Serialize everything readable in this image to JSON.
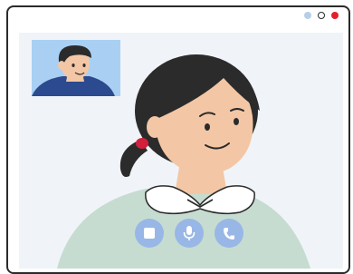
{
  "window": {
    "controls": [
      {
        "name": "minimize",
        "color": "#b7cfe6"
      },
      {
        "name": "maximize",
        "color": "#ffffff"
      },
      {
        "name": "close",
        "color": "#e2202c"
      }
    ]
  },
  "call": {
    "main_participant": "woman-avatar",
    "self_view": "man-avatar",
    "background_color": "#f0f4f8",
    "self_view_background": "#a9d0f3"
  },
  "controls": [
    {
      "icon": "stop-icon",
      "color": "#98b7e6"
    },
    {
      "icon": "microphone-icon",
      "color": "#98b7e6"
    },
    {
      "icon": "phone-icon",
      "color": "#98b7e6"
    }
  ]
}
